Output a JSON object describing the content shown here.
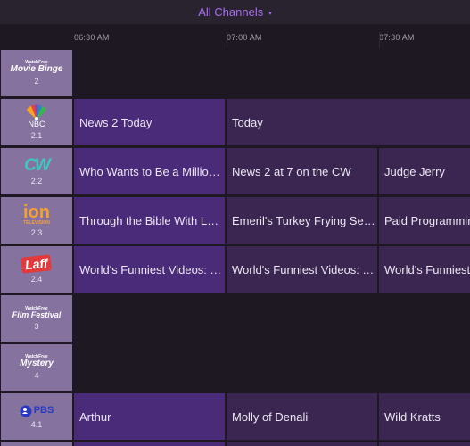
{
  "header": {
    "title": "All Channels",
    "chevron": "▾"
  },
  "timeline": {
    "times": [
      "06:30 AM",
      "07:00 AM",
      "07:30 AM"
    ]
  },
  "colors": {
    "accent": "#a86ff0",
    "now_cell": "#4a2b7a",
    "later_cell": "#3a2651",
    "channel_tile": "#85729f"
  },
  "channels": [
    {
      "logo": "watchfree-movie-binge-logo",
      "logo_small": "WatchFree",
      "logo_main": "Movie Binge",
      "number": "2",
      "programs": []
    },
    {
      "logo": "nbc-logo",
      "logo_main": "NBC",
      "number": "2.1",
      "programs": [
        "News 2 Today",
        "Today"
      ]
    },
    {
      "logo": "cw-logo",
      "logo_main": "CW",
      "number": "2.2",
      "programs": [
        "Who Wants to Be a Millionaire",
        "News 2 at 7 on the CW",
        "Judge Jerry"
      ]
    },
    {
      "logo": "ion-television-logo",
      "logo_main": "ion",
      "logo_sub": "TELEVISION",
      "number": "2.3",
      "programs": [
        "Through the Bible With Les Feldick",
        "Emeril's Turkey Frying Secrets",
        "Paid Programming"
      ]
    },
    {
      "logo": "laff-logo",
      "logo_main": "Laff",
      "number": "2.4",
      "programs": [
        "World's Funniest Videos: T...",
        "World's Funniest Videos: T...",
        "World's Funniest"
      ]
    },
    {
      "logo": "watchfree-film-festival-logo",
      "logo_small": "WatchFree",
      "logo_main": "Film Festival",
      "number": "3",
      "programs": []
    },
    {
      "logo": "watchfree-mystery-logo",
      "logo_small": "WatchFree",
      "logo_main": "Mystery",
      "number": "4",
      "programs": []
    },
    {
      "logo": "pbs-logo",
      "logo_main": "PBS",
      "number": "4.1",
      "programs": [
        "Arthur",
        "Molly of Denali",
        "Wild Kratts"
      ]
    }
  ]
}
